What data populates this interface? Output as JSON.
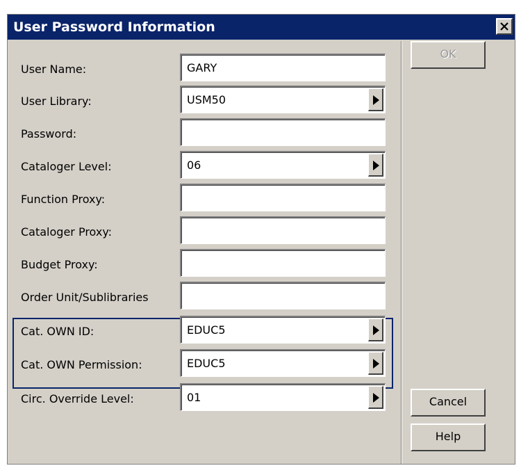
{
  "window": {
    "title": "User Password Information",
    "close_icon": "close-icon"
  },
  "fields": [
    {
      "label": "User Name:",
      "value": "GARY",
      "has_dropdown": false
    },
    {
      "label": "User Library:",
      "value": "USM50",
      "has_dropdown": true
    },
    {
      "label": "Password:",
      "value": "",
      "has_dropdown": false
    },
    {
      "label": "Cataloger Level:",
      "value": "06",
      "has_dropdown": true
    },
    {
      "label": "Function Proxy:",
      "value": "",
      "has_dropdown": false
    },
    {
      "label": "Cataloger Proxy:",
      "value": "",
      "has_dropdown": false
    },
    {
      "label": "Budget Proxy:",
      "value": "",
      "has_dropdown": false
    },
    {
      "label": "Order Unit/Sublibraries",
      "value": "",
      "has_dropdown": false
    },
    {
      "label": "Cat. OWN ID:",
      "value": "EDUC5",
      "has_dropdown": true
    },
    {
      "label": "Cat. OWN Permission:",
      "value": "EDUC5",
      "has_dropdown": true
    },
    {
      "label": "Circ. Override Level:",
      "value": "01",
      "has_dropdown": true
    }
  ],
  "buttons": {
    "ok": "OK",
    "cancel": "Cancel",
    "help": "Help"
  },
  "colors": {
    "titlebar": "#0a246a",
    "dialog_bg": "#d4d0c8",
    "highlight_border": "#0a246a"
  }
}
